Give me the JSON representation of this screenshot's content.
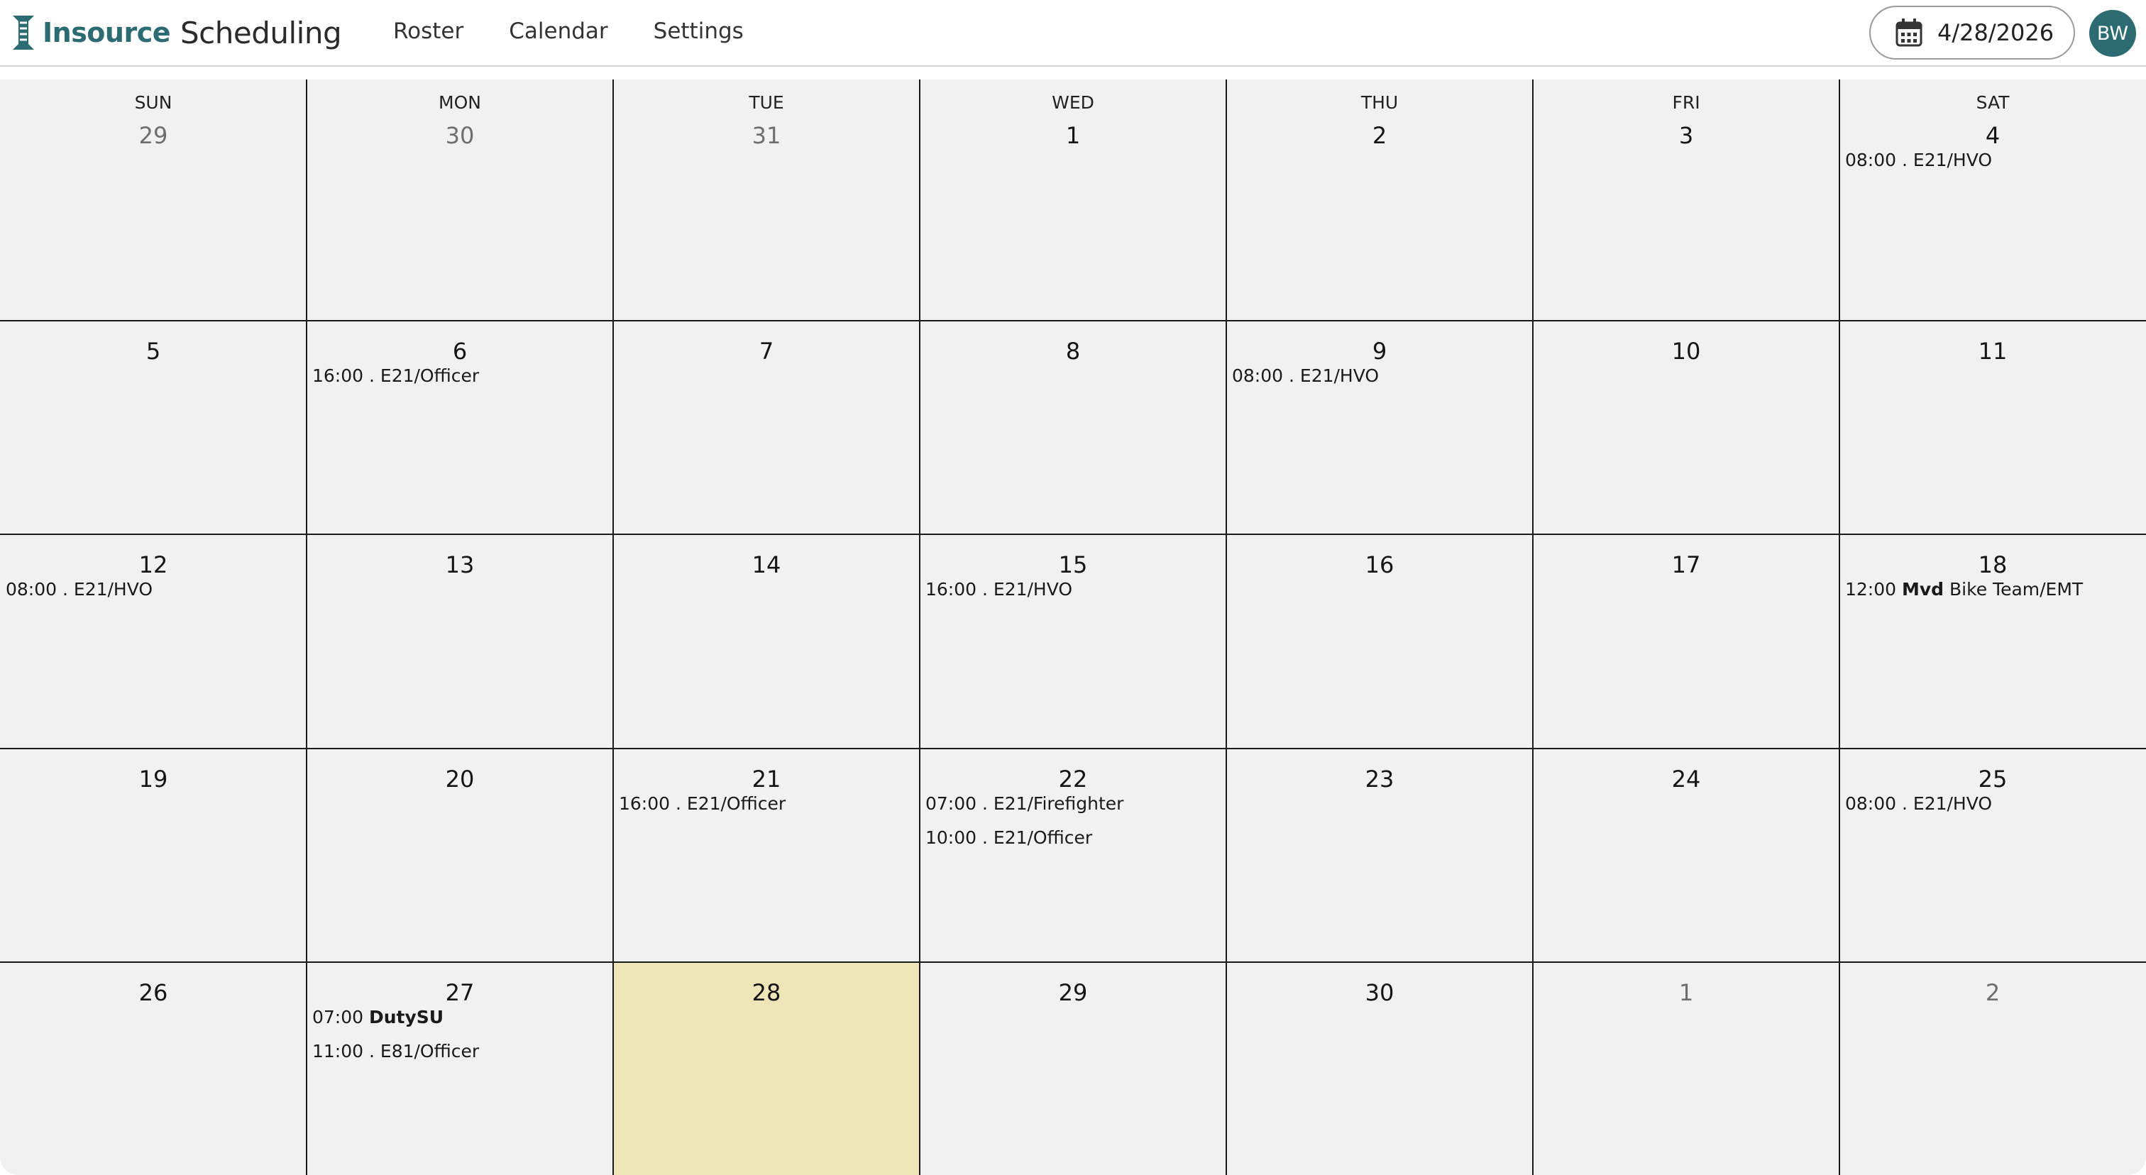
{
  "app": {
    "brand_bold": "Insource",
    "brand_light": "Scheduling"
  },
  "nav": [
    {
      "label": "Roster"
    },
    {
      "label": "Calendar"
    },
    {
      "label": "Settings"
    }
  ],
  "date_picker": {
    "value": "4/28/2026",
    "icon": "calendar-icon"
  },
  "user": {
    "initials": "BW"
  },
  "colors": {
    "brand": "#2d6b72",
    "today_highlight": "#eee6b8",
    "cell_background": "#f1f1f1"
  },
  "calendar": {
    "weekdays": [
      "SUN",
      "MON",
      "TUE",
      "WED",
      "THU",
      "FRI",
      "SAT"
    ],
    "weeks": [
      [
        {
          "day": "29",
          "muted": true,
          "events": []
        },
        {
          "day": "30",
          "muted": true,
          "events": []
        },
        {
          "day": "31",
          "muted": true,
          "events": []
        },
        {
          "day": "1",
          "events": []
        },
        {
          "day": "2",
          "events": []
        },
        {
          "day": "3",
          "events": []
        },
        {
          "day": "4",
          "events": [
            {
              "time": "08:00",
              "text": ". E21/HVO"
            }
          ]
        }
      ],
      [
        {
          "day": "5",
          "events": []
        },
        {
          "day": "6",
          "events": [
            {
              "time": "16:00",
              "text": ". E21/Officer"
            }
          ]
        },
        {
          "day": "7",
          "events": []
        },
        {
          "day": "8",
          "events": []
        },
        {
          "day": "9",
          "events": [
            {
              "time": "08:00",
              "text": ". E21/HVO"
            }
          ]
        },
        {
          "day": "10",
          "events": []
        },
        {
          "day": "11",
          "events": []
        }
      ],
      [
        {
          "day": "12",
          "events": [
            {
              "time": "08:00",
              "text": ". E21/HVO"
            }
          ]
        },
        {
          "day": "13",
          "events": []
        },
        {
          "day": "14",
          "events": []
        },
        {
          "day": "15",
          "events": [
            {
              "time": "16:00",
              "text": ". E21/HVO"
            }
          ]
        },
        {
          "day": "16",
          "events": []
        },
        {
          "day": "17",
          "events": []
        },
        {
          "day": "18",
          "events": [
            {
              "time": "12:00",
              "bold": "Mvd",
              "text": "Bike Team/EMT"
            }
          ]
        }
      ],
      [
        {
          "day": "19",
          "events": []
        },
        {
          "day": "20",
          "events": []
        },
        {
          "day": "21",
          "events": [
            {
              "time": "16:00",
              "text": ". E21/Officer"
            }
          ]
        },
        {
          "day": "22",
          "events": [
            {
              "time": "07:00",
              "text": ". E21/Firefighter"
            },
            {
              "time": "10:00",
              "text": ". E21/Officer"
            }
          ]
        },
        {
          "day": "23",
          "events": []
        },
        {
          "day": "24",
          "events": []
        },
        {
          "day": "25",
          "events": [
            {
              "time": "08:00",
              "text": ". E21/HVO"
            }
          ]
        }
      ],
      [
        {
          "day": "26",
          "events": []
        },
        {
          "day": "27",
          "events": [
            {
              "time": "07:00",
              "bold": "DutySU",
              "text": ""
            },
            {
              "time": "11:00",
              "text": ". E81/Officer"
            }
          ]
        },
        {
          "day": "28",
          "today": true,
          "events": []
        },
        {
          "day": "29",
          "events": []
        },
        {
          "day": "30",
          "events": []
        },
        {
          "day": "1",
          "muted": true,
          "events": []
        },
        {
          "day": "2",
          "muted": true,
          "events": []
        }
      ]
    ]
  }
}
